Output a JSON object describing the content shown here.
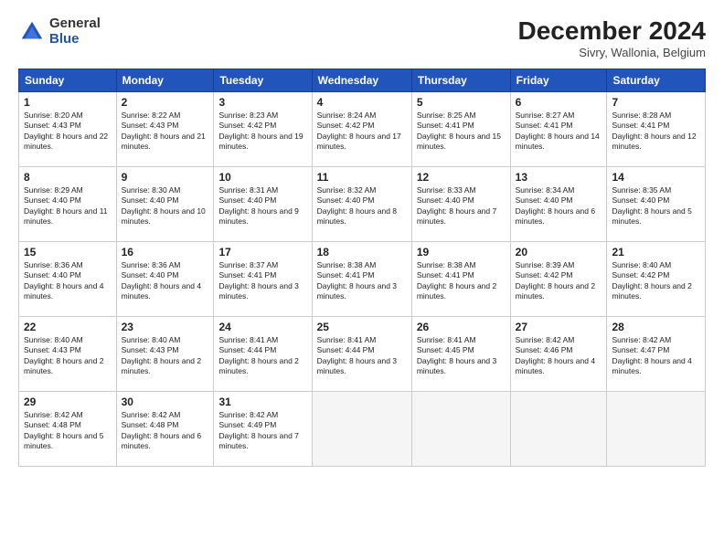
{
  "header": {
    "logo_general": "General",
    "logo_blue": "Blue",
    "month_title": "December 2024",
    "subtitle": "Sivry, Wallonia, Belgium"
  },
  "days_of_week": [
    "Sunday",
    "Monday",
    "Tuesday",
    "Wednesday",
    "Thursday",
    "Friday",
    "Saturday"
  ],
  "weeks": [
    [
      {
        "day": "1",
        "sunrise": "8:20 AM",
        "sunset": "4:43 PM",
        "daylight": "8 hours and 22 minutes."
      },
      {
        "day": "2",
        "sunrise": "8:22 AM",
        "sunset": "4:43 PM",
        "daylight": "8 hours and 21 minutes."
      },
      {
        "day": "3",
        "sunrise": "8:23 AM",
        "sunset": "4:42 PM",
        "daylight": "8 hours and 19 minutes."
      },
      {
        "day": "4",
        "sunrise": "8:24 AM",
        "sunset": "4:42 PM",
        "daylight": "8 hours and 17 minutes."
      },
      {
        "day": "5",
        "sunrise": "8:25 AM",
        "sunset": "4:41 PM",
        "daylight": "8 hours and 15 minutes."
      },
      {
        "day": "6",
        "sunrise": "8:27 AM",
        "sunset": "4:41 PM",
        "daylight": "8 hours and 14 minutes."
      },
      {
        "day": "7",
        "sunrise": "8:28 AM",
        "sunset": "4:41 PM",
        "daylight": "8 hours and 12 minutes."
      }
    ],
    [
      {
        "day": "8",
        "sunrise": "8:29 AM",
        "sunset": "4:40 PM",
        "daylight": "8 hours and 11 minutes."
      },
      {
        "day": "9",
        "sunrise": "8:30 AM",
        "sunset": "4:40 PM",
        "daylight": "8 hours and 10 minutes."
      },
      {
        "day": "10",
        "sunrise": "8:31 AM",
        "sunset": "4:40 PM",
        "daylight": "8 hours and 9 minutes."
      },
      {
        "day": "11",
        "sunrise": "8:32 AM",
        "sunset": "4:40 PM",
        "daylight": "8 hours and 8 minutes."
      },
      {
        "day": "12",
        "sunrise": "8:33 AM",
        "sunset": "4:40 PM",
        "daylight": "8 hours and 7 minutes."
      },
      {
        "day": "13",
        "sunrise": "8:34 AM",
        "sunset": "4:40 PM",
        "daylight": "8 hours and 6 minutes."
      },
      {
        "day": "14",
        "sunrise": "8:35 AM",
        "sunset": "4:40 PM",
        "daylight": "8 hours and 5 minutes."
      }
    ],
    [
      {
        "day": "15",
        "sunrise": "8:36 AM",
        "sunset": "4:40 PM",
        "daylight": "8 hours and 4 minutes."
      },
      {
        "day": "16",
        "sunrise": "8:36 AM",
        "sunset": "4:40 PM",
        "daylight": "8 hours and 4 minutes."
      },
      {
        "day": "17",
        "sunrise": "8:37 AM",
        "sunset": "4:41 PM",
        "daylight": "8 hours and 3 minutes."
      },
      {
        "day": "18",
        "sunrise": "8:38 AM",
        "sunset": "4:41 PM",
        "daylight": "8 hours and 3 minutes."
      },
      {
        "day": "19",
        "sunrise": "8:38 AM",
        "sunset": "4:41 PM",
        "daylight": "8 hours and 2 minutes."
      },
      {
        "day": "20",
        "sunrise": "8:39 AM",
        "sunset": "4:42 PM",
        "daylight": "8 hours and 2 minutes."
      },
      {
        "day": "21",
        "sunrise": "8:40 AM",
        "sunset": "4:42 PM",
        "daylight": "8 hours and 2 minutes."
      }
    ],
    [
      {
        "day": "22",
        "sunrise": "8:40 AM",
        "sunset": "4:43 PM",
        "daylight": "8 hours and 2 minutes."
      },
      {
        "day": "23",
        "sunrise": "8:40 AM",
        "sunset": "4:43 PM",
        "daylight": "8 hours and 2 minutes."
      },
      {
        "day": "24",
        "sunrise": "8:41 AM",
        "sunset": "4:44 PM",
        "daylight": "8 hours and 2 minutes."
      },
      {
        "day": "25",
        "sunrise": "8:41 AM",
        "sunset": "4:44 PM",
        "daylight": "8 hours and 3 minutes."
      },
      {
        "day": "26",
        "sunrise": "8:41 AM",
        "sunset": "4:45 PM",
        "daylight": "8 hours and 3 minutes."
      },
      {
        "day": "27",
        "sunrise": "8:42 AM",
        "sunset": "4:46 PM",
        "daylight": "8 hours and 4 minutes."
      },
      {
        "day": "28",
        "sunrise": "8:42 AM",
        "sunset": "4:47 PM",
        "daylight": "8 hours and 4 minutes."
      }
    ],
    [
      {
        "day": "29",
        "sunrise": "8:42 AM",
        "sunset": "4:48 PM",
        "daylight": "8 hours and 5 minutes."
      },
      {
        "day": "30",
        "sunrise": "8:42 AM",
        "sunset": "4:48 PM",
        "daylight": "8 hours and 6 minutes."
      },
      {
        "day": "31",
        "sunrise": "8:42 AM",
        "sunset": "4:49 PM",
        "daylight": "8 hours and 7 minutes."
      },
      null,
      null,
      null,
      null
    ]
  ],
  "labels": {
    "sunrise": "Sunrise:",
    "sunset": "Sunset:",
    "daylight": "Daylight:"
  }
}
